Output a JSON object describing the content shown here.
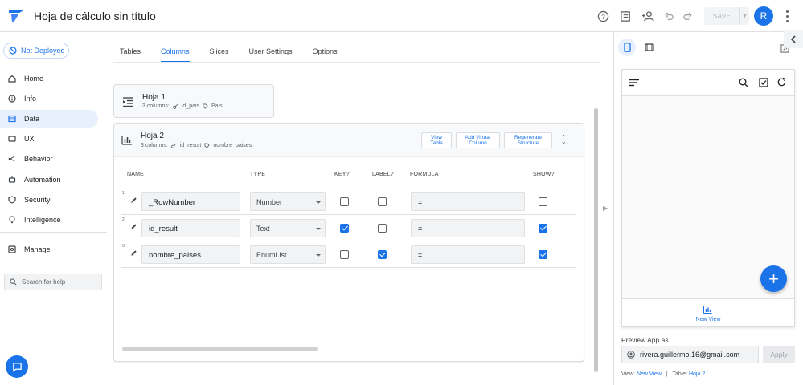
{
  "header": {
    "title": "Hoja de cálculo sin título",
    "save_label": "SAVE",
    "avatar_initial": "R",
    "icons": [
      "help-icon",
      "docs-icon",
      "share-person-icon",
      "undo-icon",
      "redo-icon",
      "more-vert-icon"
    ],
    "brand_color": "#1a73e8"
  },
  "sidebar": {
    "deploy_status": "Not Deployed",
    "items": [
      {
        "label": "Home",
        "icon": "home-icon"
      },
      {
        "label": "Info",
        "icon": "info-icon"
      },
      {
        "label": "Data",
        "icon": "data-icon",
        "active": true
      },
      {
        "label": "UX",
        "icon": "ux-icon"
      },
      {
        "label": "Behavior",
        "icon": "behavior-icon"
      },
      {
        "label": "Automation",
        "icon": "automation-icon"
      },
      {
        "label": "Security",
        "icon": "shield-icon"
      },
      {
        "label": "Intelligence",
        "icon": "lightbulb-icon"
      }
    ],
    "manage_label": "Manage",
    "search_placeholder": "Search for help"
  },
  "tabs": [
    "Tables",
    "Columns",
    "Slices",
    "User Settings",
    "Options"
  ],
  "active_tab": "Columns",
  "table1": {
    "name": "Hoja 1",
    "columns_count": "3 columns:",
    "key_col": "id_pais",
    "label_col": "Pais"
  },
  "table2": {
    "name": "Hoja 2",
    "columns_count": "3 columns:",
    "key_col": "id_result",
    "label_col": "nombre_paises",
    "actions": [
      "View\nTable",
      "Add Virtual\nColumn",
      "Regenerate\nStructure"
    ],
    "headers": {
      "name": "NAME",
      "type": "TYPE",
      "key": "KEY?",
      "label": "LABEL?",
      "formula": "FORMULA",
      "show": "SHOW?"
    },
    "rows": [
      {
        "num": "1",
        "name": "_RowNumber",
        "type": "Number",
        "key": false,
        "label": false,
        "formula": "=",
        "show": false
      },
      {
        "num": "2",
        "name": "id_result",
        "type": "Text",
        "key": true,
        "label": false,
        "formula": "=",
        "show": true
      },
      {
        "num": "3",
        "name": "nombre_paises",
        "type": "EnumList",
        "key": false,
        "label": true,
        "formula": "=",
        "show": true
      }
    ]
  },
  "preview": {
    "bottom_view_label": "New View",
    "preview_as_label": "Preview App as",
    "email": "rivera.guillermo.16@gmail.com",
    "apply_label": "Apply",
    "view_prefix": "View:",
    "view_name": "New View",
    "separator": "|",
    "table_prefix": "Table:",
    "table_name": "Hoja 2"
  }
}
